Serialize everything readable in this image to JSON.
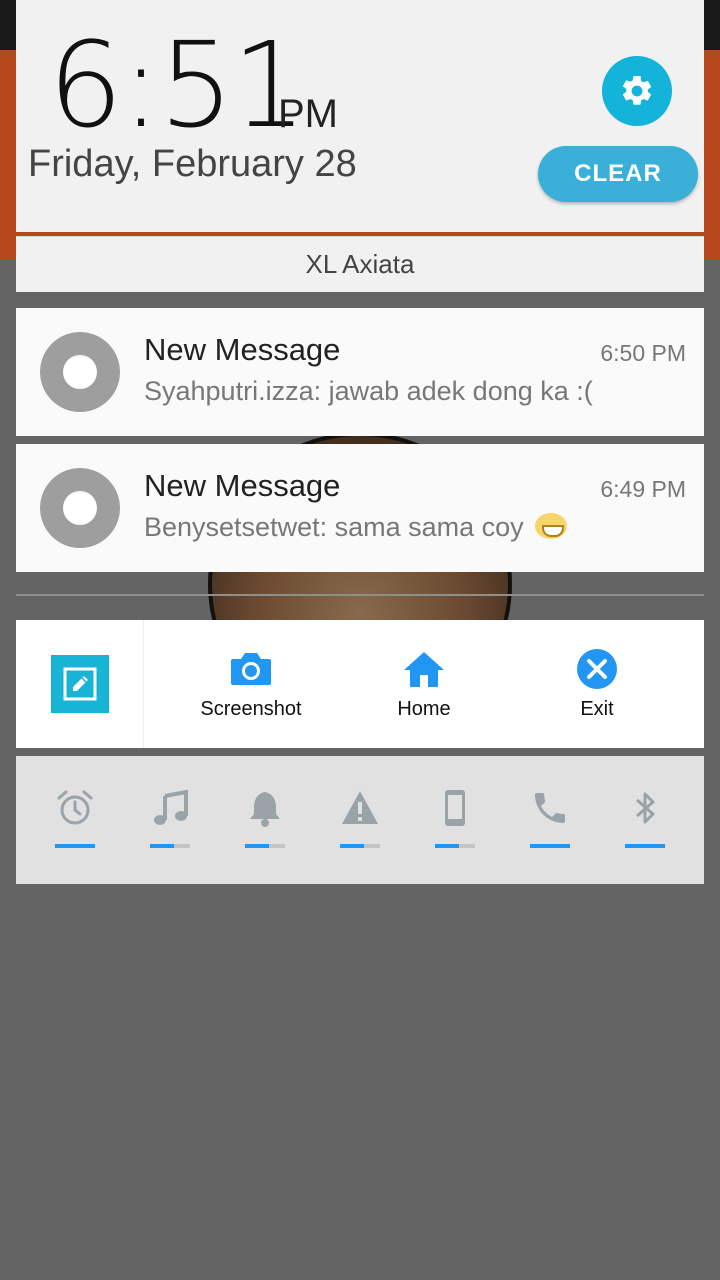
{
  "header": {
    "time": "6:51",
    "ampm": "PM",
    "date": "Friday, February 28",
    "clear_label": "CLEAR",
    "settings_icon": "gear-icon",
    "accent": "#14b3d9"
  },
  "carrier": "XL Axiata",
  "notifications": [
    {
      "title": "New Message",
      "time": "6:50 PM",
      "body": "Syahputri.izza: jawab adek dong ka :("
    },
    {
      "title": "New Message",
      "time": "6:49 PM",
      "body": "Benysetsetwet: sama sama coy",
      "emoji": "grinning-face"
    }
  ],
  "tools": {
    "items": [
      {
        "label": "Screenshot",
        "icon": "camera-icon"
      },
      {
        "label": "Home",
        "icon": "home-icon"
      },
      {
        "label": "Exit",
        "icon": "close-icon"
      }
    ],
    "icon_color": "#2196f3"
  },
  "sounds": {
    "items": [
      {
        "icon": "alarm-icon",
        "level": 1.0
      },
      {
        "icon": "music-icon",
        "level": 0.6
      },
      {
        "icon": "bell-icon",
        "level": 0.6
      },
      {
        "icon": "warning-icon",
        "level": 0.6
      },
      {
        "icon": "phone-device-icon",
        "level": 0.6
      },
      {
        "icon": "call-icon",
        "level": 1.0
      },
      {
        "icon": "bluetooth-icon",
        "level": 1.0
      }
    ],
    "fill_color": "#2196f3"
  }
}
